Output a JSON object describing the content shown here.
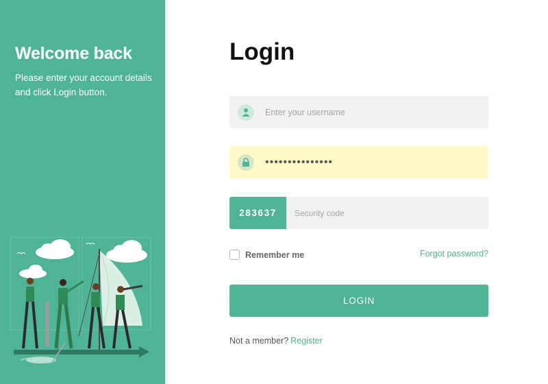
{
  "left": {
    "title": "Welcome back",
    "description": "Please enter your account details and click Login button."
  },
  "form": {
    "title": "Login",
    "username": {
      "placeholder": "Enter your username",
      "value": "",
      "icon": "user-icon"
    },
    "password": {
      "value": "•••••••••••••••",
      "icon": "lock-icon"
    },
    "captcha": {
      "code": "283637",
      "placeholder": "Security code",
      "value": ""
    },
    "remember_label": "Remember me",
    "remember_checked": false,
    "forgot_label": "Forgot password?",
    "login_label": "LOGIN",
    "member_prompt": "Not a member?",
    "register_label": "Register"
  },
  "colors": {
    "accent": "#4fb496",
    "field_bg": "#f2f2f2",
    "autofill_bg": "#fffac8"
  }
}
